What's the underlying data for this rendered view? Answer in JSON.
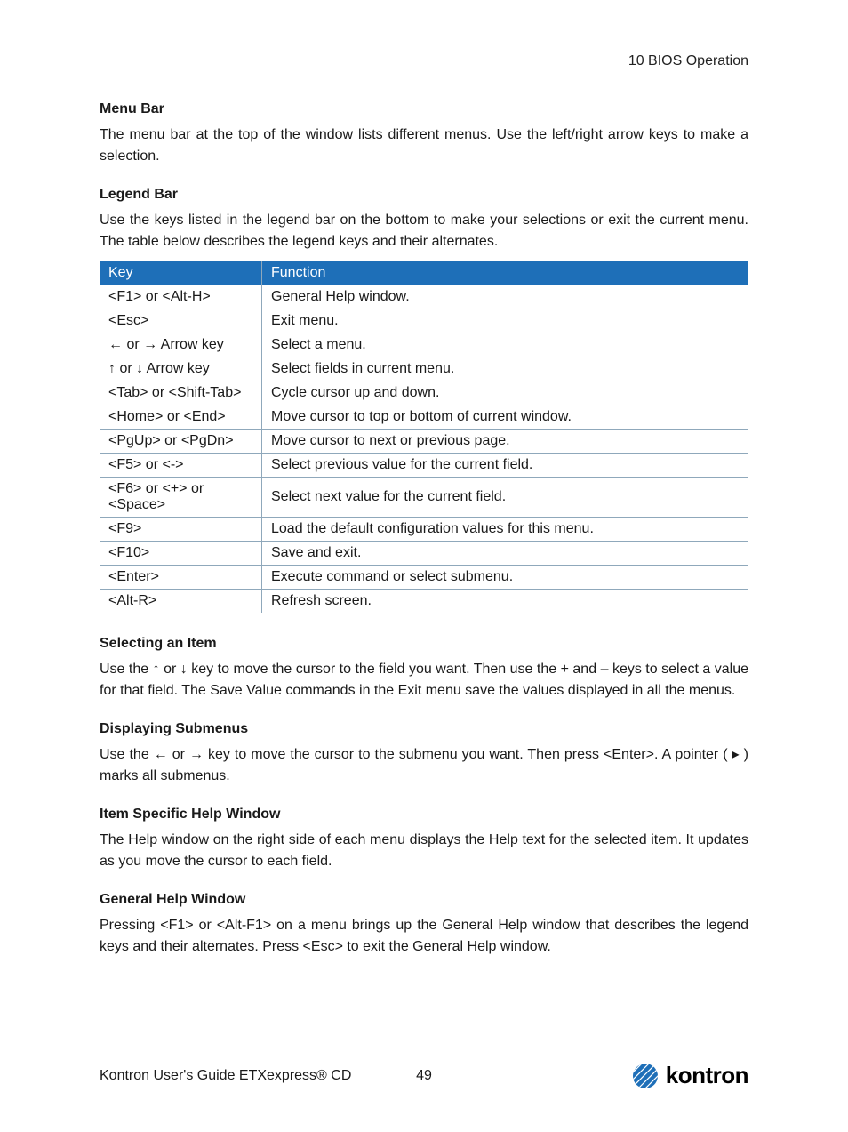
{
  "header": {
    "chapter": "10 BIOS Operation"
  },
  "sections": {
    "menu_bar": {
      "heading": "Menu Bar",
      "body": "The menu bar at the top of the window lists different menus. Use the left/right arrow keys to make a selection."
    },
    "legend_bar": {
      "heading": "Legend Bar",
      "body": "Use the keys listed in the legend bar on the bottom to make your selections or exit the current menu. The table below describes the legend keys and their alternates."
    },
    "selecting": {
      "heading": "Selecting an Item",
      "body": "Use the ↑ or ↓ key to move the cursor to the field you want. Then use the + and – keys to select a value for that field. The Save Value commands in the Exit menu save the values displayed in all the menus."
    },
    "submenus": {
      "heading": "Displaying Submenus",
      "body": "Use the ← or → key to move the cursor to the submenu you want. Then press <Enter>. A pointer ( ▸ ) marks all submenus."
    },
    "item_help": {
      "heading": "Item Specific Help Window",
      "body": "The Help window on the right side of each menu displays the Help text for the selected item. It updates as you move the cursor to each field."
    },
    "general_help": {
      "heading": "General Help Window",
      "body": "Pressing <F1> or <Alt-F1> on a menu brings up the General Help window that describes the legend keys and their alternates. Press <Esc> to exit the General Help window."
    }
  },
  "table": {
    "head_key": "Key",
    "head_function": "Function",
    "rows": [
      {
        "key": "<F1> or <Alt-H>",
        "fn": "General Help window."
      },
      {
        "key": "<Esc>",
        "fn": "Exit menu."
      },
      {
        "key": "← or → Arrow key",
        "fn": "Select a menu."
      },
      {
        "key": "↑ or ↓ Arrow key",
        "fn": "Select fields in current menu."
      },
      {
        "key": "<Tab> or <Shift-Tab>",
        "fn": "Cycle cursor up and down."
      },
      {
        "key": "<Home> or <End>",
        "fn": "Move cursor to top or bottom of current window."
      },
      {
        "key": "<PgUp> or <PgDn>",
        "fn": "Move cursor to next or previous page."
      },
      {
        "key": "<F5> or <->",
        "fn": "Select previous value for the current field."
      },
      {
        "key": "<F6> or <+> or <Space>",
        "fn": "Select next value for the current field."
      },
      {
        "key": "<F9>",
        "fn": "Load the default configuration values for this menu."
      },
      {
        "key": "<F10>",
        "fn": "Save and exit."
      },
      {
        "key": "<Enter>",
        "fn": "Execute command or select submenu."
      },
      {
        "key": "<Alt-R>",
        "fn": "Refresh screen."
      }
    ]
  },
  "footer": {
    "guide": "Kontron User's Guide ETXexpress® CD",
    "page": "49",
    "brand": "kontron"
  }
}
